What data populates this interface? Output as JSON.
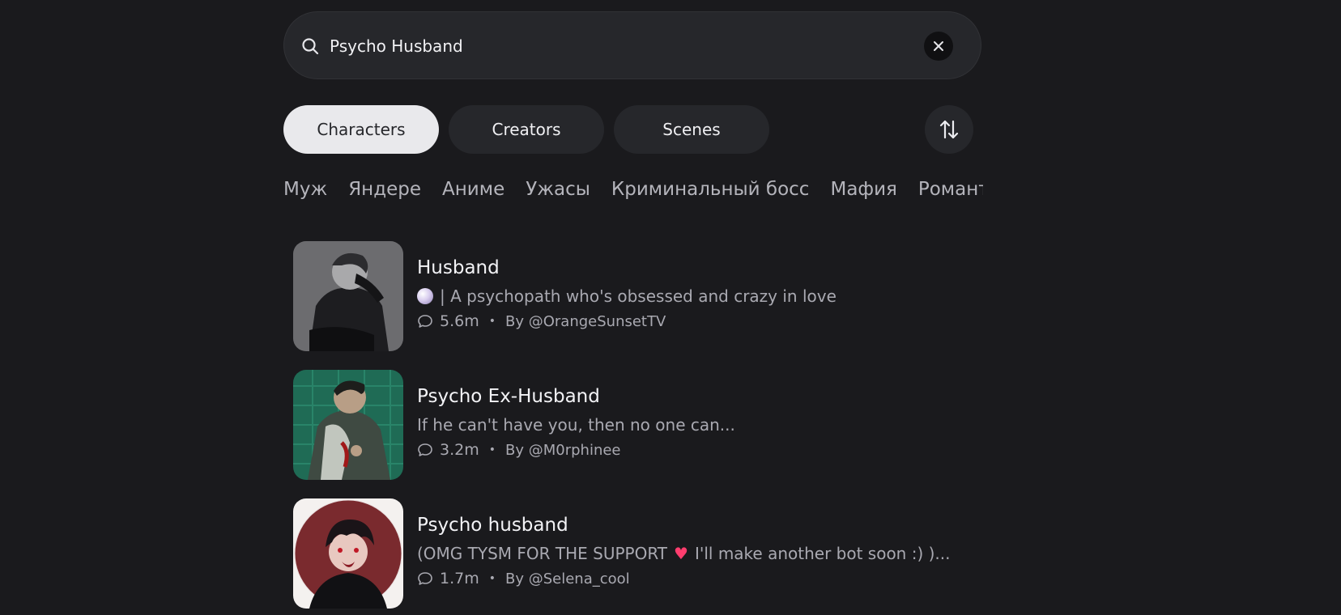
{
  "search": {
    "value": "Psycho Husband"
  },
  "tabs": [
    {
      "label": "Characters",
      "active": true
    },
    {
      "label": "Creators",
      "active": false
    },
    {
      "label": "Scenes",
      "active": false
    }
  ],
  "tags": [
    "Муж",
    "Яндере",
    "Аниме",
    "Ужасы",
    "Криминальный босс",
    "Мафия",
    "Романтика"
  ],
  "results": [
    {
      "title": "Husband",
      "description": "| A psychopath who's obsessed and crazy in love",
      "description_icon": "pearl-orb-emoji",
      "chats": "5.6m",
      "author": "By @OrangeSunsetTV"
    },
    {
      "title": "Psycho Ex-Husband",
      "description": "If he can't have you, then no one can...",
      "chats": "3.2m",
      "author": "By @M0rphinee"
    },
    {
      "title": "Psycho husband",
      "description_before": "(OMG TYSM FOR THE SUPPORT",
      "description_icon": "heart-emoji",
      "description_after": "I'll make another bot soon :) )...",
      "chats": "1.7m",
      "author": "By @Selena_cool"
    }
  ],
  "colors": {
    "background": "#1a1a1d",
    "surface": "#26272b",
    "active_tab": "#e9e9ec",
    "muted_text": "#a9a9b1",
    "heart": "#ff3d6e"
  }
}
